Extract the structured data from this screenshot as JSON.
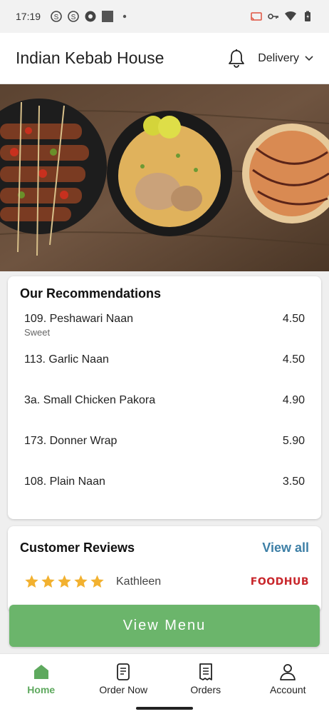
{
  "status_bar": {
    "time": "17:19"
  },
  "header": {
    "title": "Indian Kebab House",
    "mode_label": "Delivery"
  },
  "recommendations": {
    "title": "Our Recommendations",
    "items": [
      {
        "name": "109. Peshawari Naan",
        "note": "Sweet",
        "price": "4.50"
      },
      {
        "name": "113. Garlic Naan",
        "note": "",
        "price": "4.50"
      },
      {
        "name": "3a. Small Chicken Pakora",
        "note": "",
        "price": "4.90"
      },
      {
        "name": "173. Donner Wrap",
        "note": "",
        "price": "5.90"
      },
      {
        "name": "108. Plain Naan",
        "note": "",
        "price": "3.50"
      }
    ]
  },
  "reviews": {
    "title": "Customer Reviews",
    "view_all_label": "View all",
    "first_review": {
      "stars": 5,
      "name": "Kathleen",
      "source": "FOODHUB"
    }
  },
  "cta": {
    "label": "View Menu"
  },
  "bottom_nav": {
    "items": [
      {
        "label": "Home",
        "icon": "home-icon",
        "active": true
      },
      {
        "label": "Order Now",
        "icon": "order-now-icon",
        "active": false
      },
      {
        "label": "Orders",
        "icon": "orders-receipt-icon",
        "active": false
      },
      {
        "label": "Account",
        "icon": "account-icon",
        "active": false
      }
    ]
  },
  "colors": {
    "accent_green": "#6bb56b",
    "link_blue": "#3d7fa6",
    "star_gold": "#f2b130",
    "brand_red": "#c8262b"
  }
}
